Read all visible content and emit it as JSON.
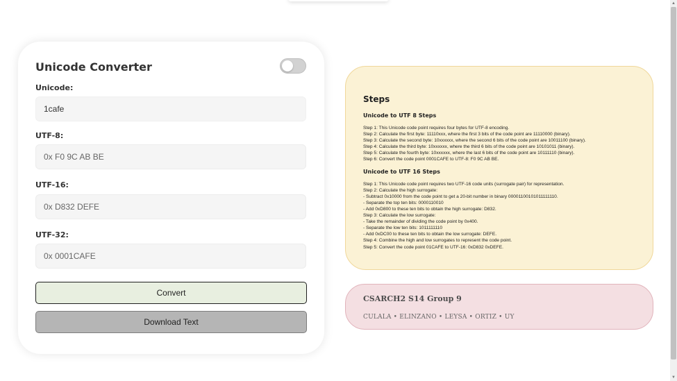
{
  "converter": {
    "title": "Unicode Converter",
    "dark_mode_toggle": "off",
    "fields": {
      "unicode": {
        "label": "Unicode:",
        "value": "1cafe"
      },
      "utf8": {
        "label": "UTF-8:",
        "value": "0x F0 9C AB BE"
      },
      "utf16": {
        "label": "UTF-16:",
        "value": "0x D832 DEFE"
      },
      "utf32": {
        "label": "UTF-32:",
        "value": "0x 0001CAFE"
      }
    },
    "convert_label": "Convert",
    "download_label": "Download Text"
  },
  "steps": {
    "title": "Steps",
    "utf8": {
      "heading": "Unicode to UTF 8 Steps",
      "lines": [
        "Step 1: This Unicode code point requires four bytes for UTF-8 encoding.",
        "Step 2: Calculate the first byte: 11110xxx, where the first 3 bits of the code point are 11110000 (binary).",
        "Step 3: Calculate the second byte: 10xxxxxx, where the second 6 bits of the code point are 10011100 (binary).",
        "Step 4: Calculate the third byte: 10xxxxxx, where the third 6 bits of the code point are 10101011 (binary).",
        "Step 5: Calculate the fourth byte: 10xxxxxx, where the last 6 bits of the code point are 10111110 (binary).",
        "Step 6: Convert the code point 0001CAFE to UTF-8: F0 9C AB BE."
      ]
    },
    "utf16": {
      "heading": "Unicode to UTF 16 Steps",
      "lines": [
        "Step 1: This Unicode code point requires two UTF-16 code units (surrogate pair) for representation.",
        "Step 2: Calculate the high surrogate:",
        "- Subtract 0x10000 from the code point to get a 20-bit number in binary 00001100101011111110.",
        "- Separate the top ten bits: 0000110010",
        "- Add 0xD800 to these ten bits to obtain the high surrogate: D832.",
        "Step 3: Calculate the low surrogate:",
        "- Take the remainder of dividing the code point by 0x400.",
        "- Separate the low ten bits: 1011111110",
        "- Add 0xDC00 to these ten bits to obtain the low surrogate: DEFE.",
        "Step 4: Combine the high and low surrogates to represent the code point.",
        "Step 5: Convert the code point 01CAFE to UTF-16: 0xD832 0xDEFE."
      ]
    }
  },
  "group": {
    "title": "CSARCH2 S14 Group 9",
    "members": "CULALA • ELINZANO • LEYSA • ORTIZ • UY"
  }
}
